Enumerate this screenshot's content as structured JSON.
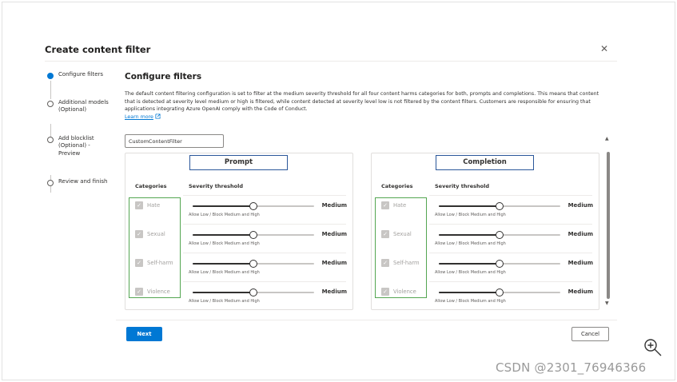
{
  "dialog": {
    "title": "Create content filter",
    "close_icon": "✕"
  },
  "stepper": {
    "steps": [
      {
        "label": "Configure filters",
        "active": true
      },
      {
        "label": "Additional models (Optional)",
        "active": false
      },
      {
        "label": "Add blocklist (Optional) - Preview",
        "active": false
      },
      {
        "label": "Review and finish",
        "active": false
      }
    ]
  },
  "main": {
    "title": "Configure filters",
    "description": "The default content filtering configuration is set to filter at the medium severity threshold for all four content harms categories for both, prompts and completions. This means that content that is detected at severity level medium or high is filtered, while content detected at severity level low is not filtered by the content filters. Customers are responsible for ensuring that applications integrating Azure OpenAI comply with the Code of Conduct.",
    "learn_more": "Learn more",
    "filter_name": "CustomContentFilter"
  },
  "panels": [
    {
      "title": "Prompt",
      "col_categories": "Categories",
      "col_threshold": "Severity threshold",
      "rows": [
        {
          "category": "Hate",
          "level": "Medium",
          "hint": "Allow Low / Block Medium and High",
          "slider": 0.5
        },
        {
          "category": "Sexual",
          "level": "Medium",
          "hint": "Allow Low / Block Medium and High",
          "slider": 0.5
        },
        {
          "category": "Self-harm",
          "level": "Medium",
          "hint": "Allow Low / Block Medium and High",
          "slider": 0.5
        },
        {
          "category": "Violence",
          "level": "Medium",
          "hint": "Allow Low / Block Medium and High",
          "slider": 0.5
        }
      ]
    },
    {
      "title": "Completion",
      "col_categories": "Categories",
      "col_threshold": "Severity threshold",
      "rows": [
        {
          "category": "Hate",
          "level": "Medium",
          "hint": "Allow Low / Block Medium and High",
          "slider": 0.5
        },
        {
          "category": "Sexual",
          "level": "Medium",
          "hint": "Allow Low / Block Medium and High",
          "slider": 0.5
        },
        {
          "category": "Self-harm",
          "level": "Medium",
          "hint": "Allow Low / Block Medium and High",
          "slider": 0.5
        },
        {
          "category": "Violence",
          "level": "Medium",
          "hint": "Allow Low / Block Medium and High",
          "slider": 0.5
        }
      ]
    }
  ],
  "footer": {
    "next_label": "Next",
    "cancel_label": "Cancel"
  },
  "colors": {
    "accent": "#0078d4",
    "highlight_border": "#2b579a",
    "green_annotation": "#54a651"
  },
  "watermark": "CSDN @2301_76946366",
  "icons": {
    "zoom": "zoom-in-icon",
    "external_link": "external-link-icon",
    "checkbox": "checkmark-icon"
  }
}
